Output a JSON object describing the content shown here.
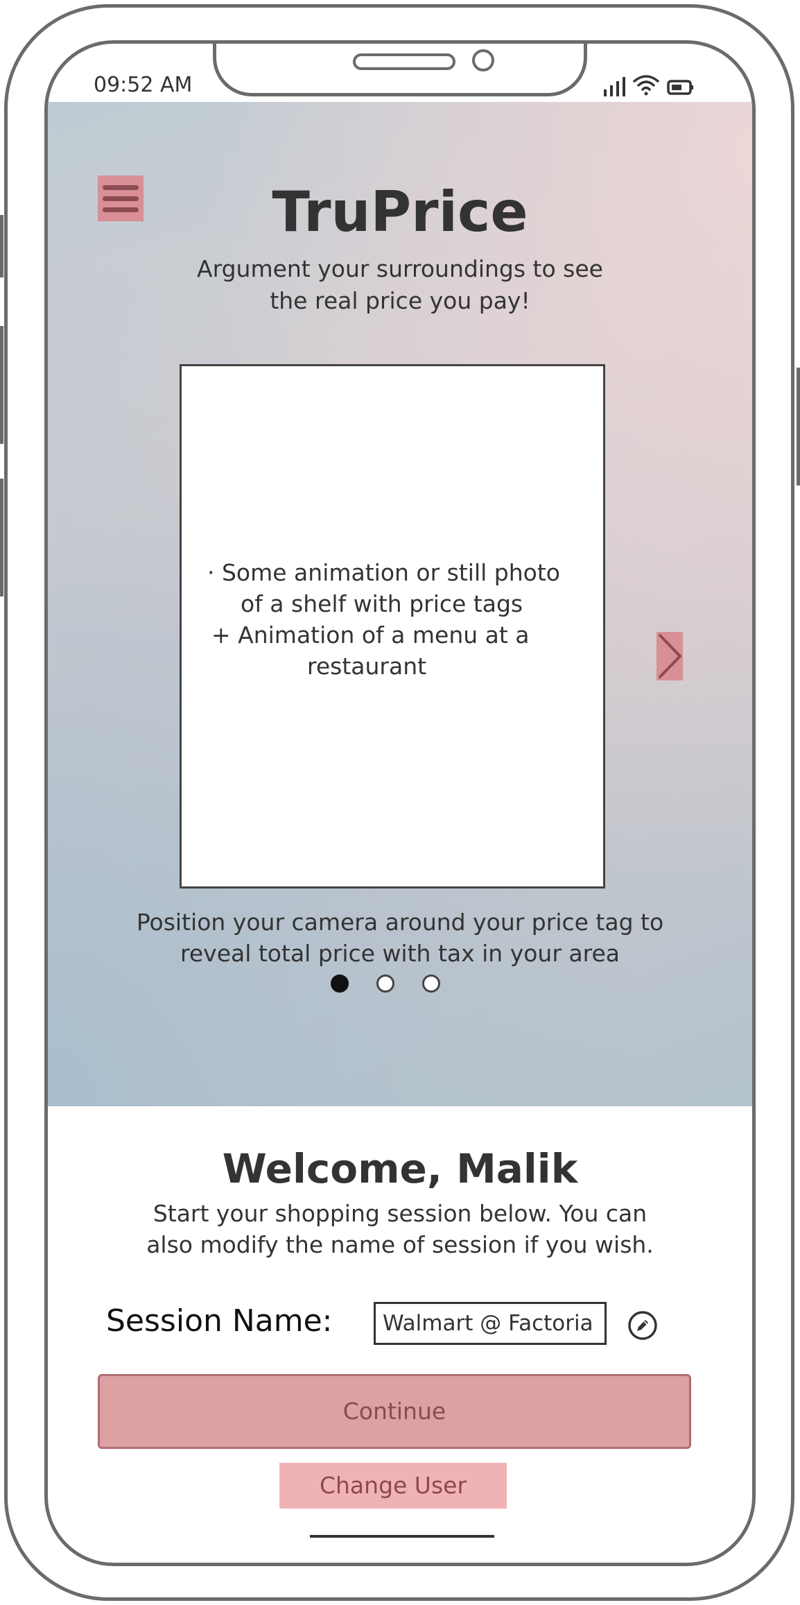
{
  "status_bar": {
    "time": "09:52 AM"
  },
  "app": {
    "title": "TruPrice",
    "tagline_line1": "Argument your surroundings to see",
    "tagline_line2": "the real price you pay!"
  },
  "carousel": {
    "placeholder_lines": [
      "·   Some animation or still photo",
      "of a shelf with price tags",
      "+ Animation of a menu at a",
      "restaurant"
    ],
    "caption_line1": "Position your camera around your price tag to",
    "caption_line2": "reveal total price with tax in your area",
    "page_count": 3,
    "active_page": 1
  },
  "welcome": {
    "heading": "Welcome, Malik",
    "subtext_line1": "Start your shopping session below. You can",
    "subtext_line2": "also modify the name of session if you wish."
  },
  "session": {
    "label": "Session Name:",
    "value": "Walmart @ Factoria"
  },
  "actions": {
    "continue_label": "Continue",
    "change_user_label": "Change User"
  },
  "colors": {
    "accent": "#d88f95",
    "accent_dark": "#8c4a52",
    "button_fill": "#dca1a3"
  },
  "icons": [
    "menu-icon",
    "chevron-right-icon",
    "pencil-icon",
    "signal-icon",
    "wifi-icon",
    "battery-icon"
  ]
}
